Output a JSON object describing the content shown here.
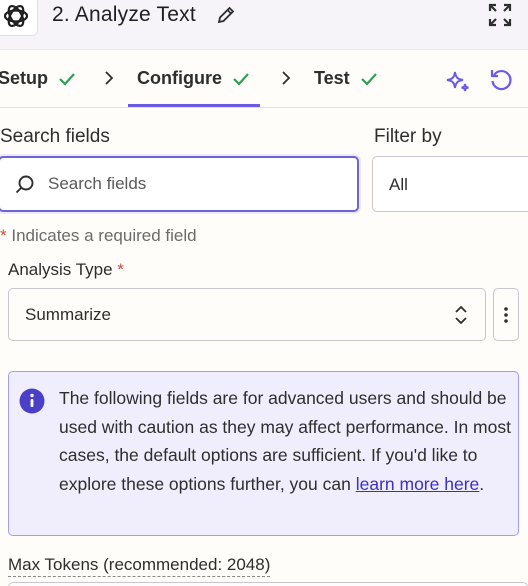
{
  "header": {
    "title": "2. Analyze Text",
    "logo_icon": "openai-logo",
    "edit_icon": "pencil-icon",
    "expand_icon": "expand-icon"
  },
  "tabs": [
    {
      "label": "Setup",
      "complete": true
    },
    {
      "label": "Configure",
      "complete": true,
      "active": true
    },
    {
      "label": "Test",
      "complete": true
    }
  ],
  "toolbar": {
    "ai_icon": "sparkle-icon",
    "refresh_icon": "refresh-icon"
  },
  "search": {
    "label": "Search fields",
    "placeholder": "Search fields",
    "value": ""
  },
  "filter": {
    "label": "Filter by",
    "value": "All"
  },
  "required_note": {
    "star": "*",
    "text": " Indicates a required field"
  },
  "analysis_type": {
    "label": "Analysis Type",
    "required_star": "*",
    "value": "Summarize"
  },
  "info": {
    "text_before_link": "The following fields are for advanced users and should be used with caution as they may affect performance. In most cases, the default options are sufficient. If you'd like to explore these options further, you can ",
    "link_text": "learn more here",
    "text_after_link": "."
  },
  "max_tokens": {
    "label": "Max Tokens (recommended: 2048)"
  },
  "colors": {
    "accent": "#695be8",
    "check": "#2e9e5b",
    "required": "#d6483b",
    "info_bg": "#f0eefc",
    "info_icon": "#4a3fc7"
  }
}
